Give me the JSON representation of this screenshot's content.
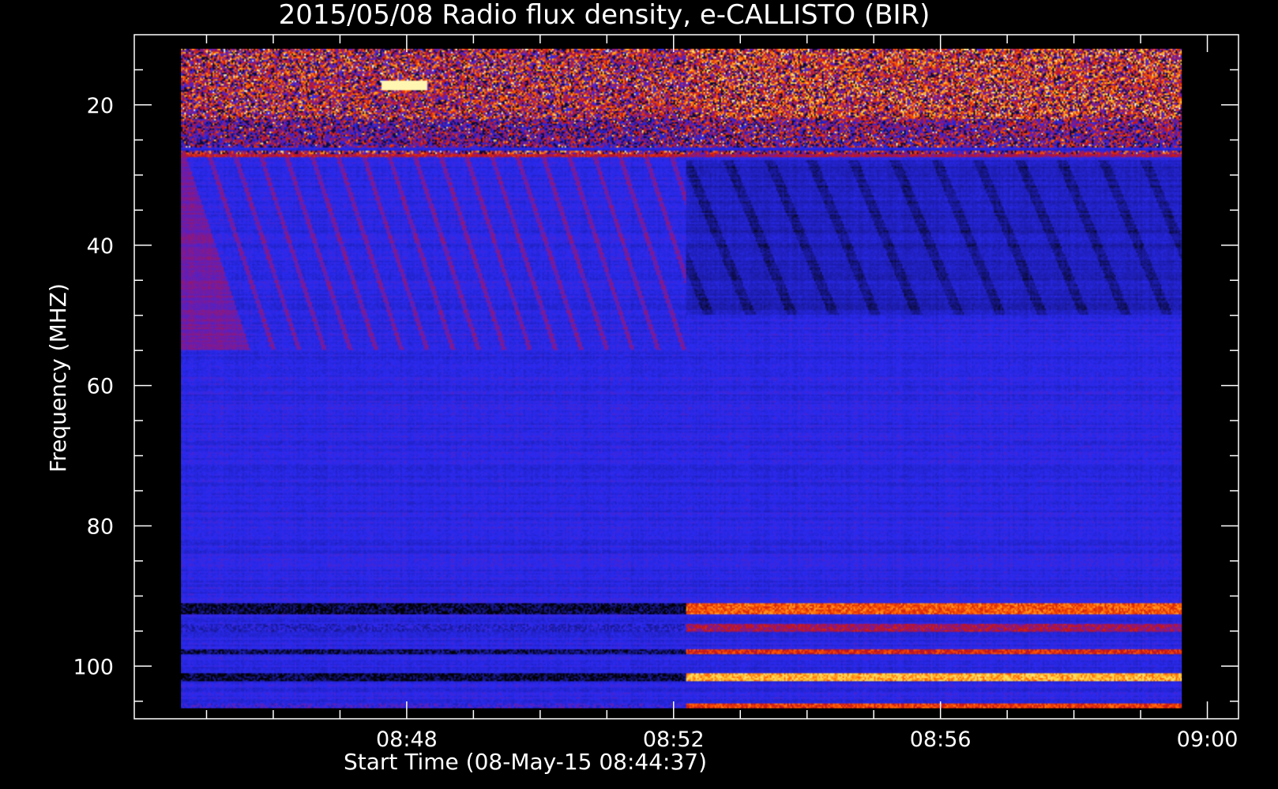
{
  "chart_data": {
    "type": "heatmap",
    "title": "2015/05/08  Radio flux density, e-CALLISTO (BIR)",
    "xlabel": "Start Time (08-May-15 08:44:37)",
    "ylabel": "Frequency (MHZ)",
    "x_ticks": [
      "08:48",
      "08:52",
      "08:56",
      "09:00"
    ],
    "x_tick_minutes": [
      3.383,
      7.383,
      11.383,
      15.383
    ],
    "x_minor_step_minutes": 1,
    "x_range_minutes": [
      -0.7,
      15.85
    ],
    "data_x_range_minutes": [
      0.0,
      15.0
    ],
    "y_ticks": [
      "20",
      "40",
      "60",
      "80",
      "100"
    ],
    "y_tick_values": [
      20,
      40,
      60,
      80,
      100
    ],
    "y_minor_step": 5,
    "ylim": [
      10,
      107.5
    ],
    "y_inverted": true,
    "data_y_range": [
      12,
      106
    ],
    "transition_minute": 7.58,
    "colormap": [
      "#000000",
      "#1a1aa0",
      "#2a2af0",
      "#7a1a9a",
      "#c81414",
      "#ff5a00",
      "#ffd23c",
      "#ffffd0"
    ],
    "interference_bands_mhz": [
      {
        "from": 12,
        "to": 22,
        "level_before": 0.55,
        "level_after": 0.6
      },
      {
        "from": 22,
        "to": 26,
        "level_before": 0.4,
        "level_after": 0.45
      },
      {
        "from": 26.5,
        "to": 27.5,
        "level_before": 0.55,
        "level_after": 0.5
      },
      {
        "from": 91,
        "to": 92.5,
        "level_before": 0.05,
        "level_after": 0.7
      },
      {
        "from": 94,
        "to": 95,
        "level_before": 0.22,
        "level_after": 0.5
      },
      {
        "from": 97.5,
        "to": 98.2,
        "level_before": 0.08,
        "level_after": 0.62
      },
      {
        "from": 101,
        "to": 102.2,
        "level_before": 0.05,
        "level_after": 0.82
      },
      {
        "from": 105.3,
        "to": 106,
        "level_before": 0.3,
        "level_after": 0.65
      }
    ]
  }
}
